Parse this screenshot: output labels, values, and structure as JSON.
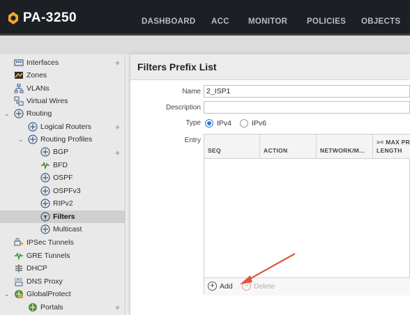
{
  "app": {
    "device": "PA-3250"
  },
  "nav": [
    {
      "label": "DASHBOARD"
    },
    {
      "label": "ACC"
    },
    {
      "label": "MONITOR"
    },
    {
      "label": "POLICIES"
    },
    {
      "label": "OBJECTS"
    }
  ],
  "sidebar": {
    "items": [
      {
        "label": "Interfaces",
        "icon": "interfaces-icon"
      },
      {
        "label": "Zones",
        "icon": "zones-icon"
      },
      {
        "label": "VLANs",
        "icon": "vlans-icon"
      },
      {
        "label": "Virtual Wires",
        "icon": "virtual-wires-icon"
      },
      {
        "label": "Routing",
        "icon": "routing-icon"
      },
      {
        "label": "Logical Routers",
        "icon": "router-icon"
      },
      {
        "label": "Routing Profiles",
        "icon": "router-icon"
      },
      {
        "label": "BGP",
        "icon": "router-icon"
      },
      {
        "label": "BFD",
        "icon": "bfd-icon"
      },
      {
        "label": "OSPF",
        "icon": "router-icon"
      },
      {
        "label": "OSPFv3",
        "icon": "router-icon"
      },
      {
        "label": "RIPv2",
        "icon": "router-icon"
      },
      {
        "label": "Filters",
        "icon": "filter-icon"
      },
      {
        "label": "Multicast",
        "icon": "router-icon"
      },
      {
        "label": "IPSec Tunnels",
        "icon": "ipsec-icon"
      },
      {
        "label": "GRE Tunnels",
        "icon": "gre-icon"
      },
      {
        "label": "DHCP",
        "icon": "dhcp-icon"
      },
      {
        "label": "DNS Proxy",
        "icon": "dns-proxy-icon"
      },
      {
        "label": "GlobalProtect",
        "icon": "globalprotect-icon"
      },
      {
        "label": "Portals",
        "icon": "portals-icon"
      }
    ]
  },
  "dialog": {
    "title": "Filters Prefix List",
    "name_label": "Name",
    "name_value": "2_ISP1",
    "description_label": "Description",
    "description_value": "",
    "type_label": "Type",
    "type_options": [
      "IPv4",
      "IPv6"
    ],
    "type_selected": "IPv4",
    "entry_label": "Entry",
    "columns": [
      "SEQ",
      "ACTION",
      "NETWORK/M...",
      ">= MAX PR\nLENGTH"
    ],
    "add_label": "Add",
    "delete_label": "Delete"
  },
  "colors": {
    "accent": "#2a7bd6",
    "arrow": "#e0553a",
    "topbar": "#1c1f24",
    "logo": "#f0a830"
  }
}
